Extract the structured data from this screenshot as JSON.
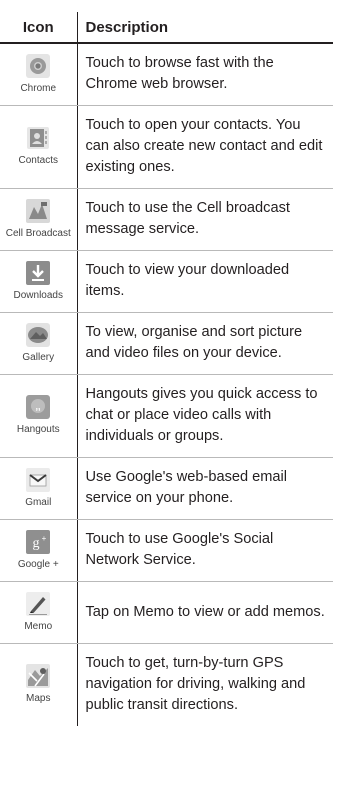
{
  "header": {
    "icon": "Icon",
    "description": "Description"
  },
  "rows": [
    {
      "label": "Chrome",
      "icon": "chrome-icon",
      "description": "Touch to browse fast with the Chrome web browser."
    },
    {
      "label": "Contacts",
      "icon": "contacts-icon",
      "description": "Touch to open your contacts. You can also create new contact and edit existing ones."
    },
    {
      "label": "Cell Broadcast",
      "icon": "cell-broadcast-icon",
      "description": "Touch to use the Cell broadcast message service."
    },
    {
      "label": "Downloads",
      "icon": "downloads-icon",
      "description": "Touch to view your downloaded items."
    },
    {
      "label": "Gallery",
      "icon": "gallery-icon",
      "description": "To view, organise and sort picture and video files on your device."
    },
    {
      "label": "Hangouts",
      "icon": "hangouts-icon",
      "description": "Hangouts gives you quick access to chat or place video calls with individuals or groups."
    },
    {
      "label": "Gmail",
      "icon": "gmail-icon",
      "description": "Use Google's web-based email service on your phone."
    },
    {
      "label": "Google +",
      "icon": "google-plus-icon",
      "description": "Touch to use Google's Social Network Service."
    },
    {
      "label": "Memo",
      "icon": "memo-icon",
      "description": "Tap on Memo to view or add memos."
    },
    {
      "label": "Maps",
      "icon": "maps-icon",
      "description": "Touch to get, turn-by-turn GPS navigation for driving, walking and public transit directions."
    }
  ]
}
